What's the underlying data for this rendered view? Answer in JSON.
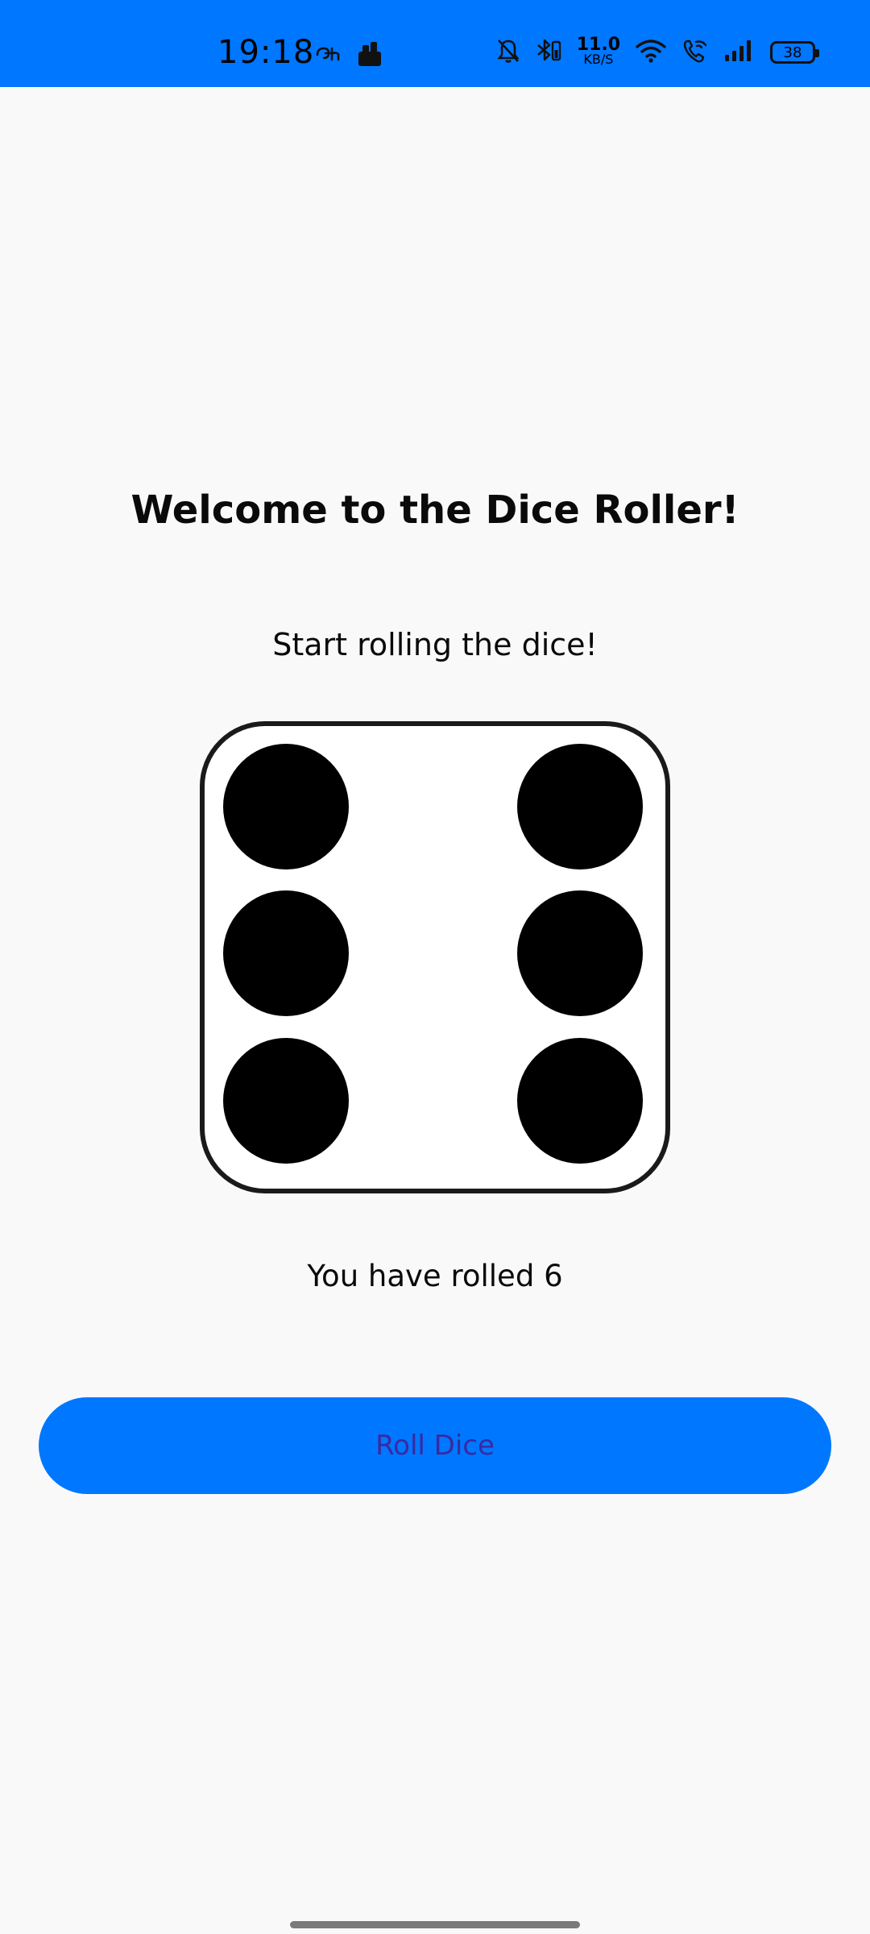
{
  "status_bar": {
    "time": "19:18",
    "net_speed_value": "11.0",
    "net_speed_unit": "KB/S",
    "battery_level": "38",
    "background_color": "#0077ff",
    "left_icons": [
      "notification-app-icon",
      "storage-app-icon"
    ],
    "right_icons": [
      "bell-muted-icon",
      "bluetooth-icon",
      "wifi-icon",
      "wifi-calling-icon",
      "signal-icon",
      "battery-icon"
    ]
  },
  "main": {
    "title": "Welcome to the Dice Roller!",
    "subtitle": "Start rolling the dice!",
    "die_value": 6,
    "rolled_text": "You have rolled 6",
    "roll_button_label": "Roll Dice"
  },
  "colors": {
    "accent": "#0077ff",
    "button_text": "#3a2aa0",
    "background": "#f9f9f9"
  }
}
